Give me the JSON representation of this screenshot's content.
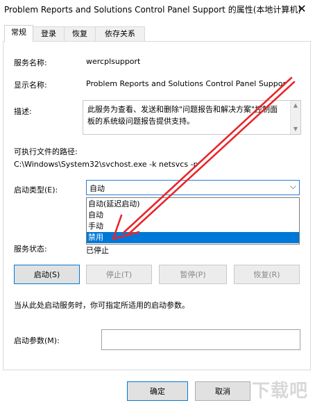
{
  "window": {
    "title": "Problem Reports and Solutions Control Panel Support 的属性(本地计算机)",
    "close_glyph": "✕"
  },
  "tabs": [
    {
      "label": "常规",
      "active": true
    },
    {
      "label": "登录",
      "active": false
    },
    {
      "label": "恢复",
      "active": false
    },
    {
      "label": "依存关系",
      "active": false
    }
  ],
  "general": {
    "service_name_label": "服务名称:",
    "service_name_value": "wercplsupport",
    "display_name_label": "显示名称:",
    "display_name_value": "Problem Reports and Solutions Control Panel Suppor",
    "description_label": "描述:",
    "description_value": "此服务为查看、发送和删除\"问题报告和解决方案\"控制面板的系统级问题报告提供支持。",
    "exe_path_label": "可执行文件的路径:",
    "exe_path_value": "C:\\Windows\\System32\\svchost.exe -k netsvcs -p",
    "startup_type_label": "启动类型(E):",
    "startup_type_value": "自动",
    "startup_options": [
      "自动(延迟启动)",
      "自动",
      "手动",
      "禁用"
    ],
    "startup_highlighted": "禁用",
    "service_status_label": "服务状态:",
    "service_status_value": "已停止",
    "start_button": "启动(S)",
    "stop_button": "停止(T)",
    "pause_button": "暂停(P)",
    "resume_button": "恢复(R)",
    "hint_text": "当从此处启动服务时，你可指定所适用的启动参数。",
    "start_params_label": "启动参数(M):",
    "start_params_value": ""
  },
  "footer": {
    "ok_button": "确定",
    "cancel_button": "取消"
  },
  "annotation": {
    "arrow_color": "#e8262a"
  },
  "icons": {
    "chevron": "chevron-down-icon",
    "scroll_up": "scroll-up-icon",
    "scroll_down": "scroll-down-icon"
  },
  "watermark_text": "下载吧"
}
